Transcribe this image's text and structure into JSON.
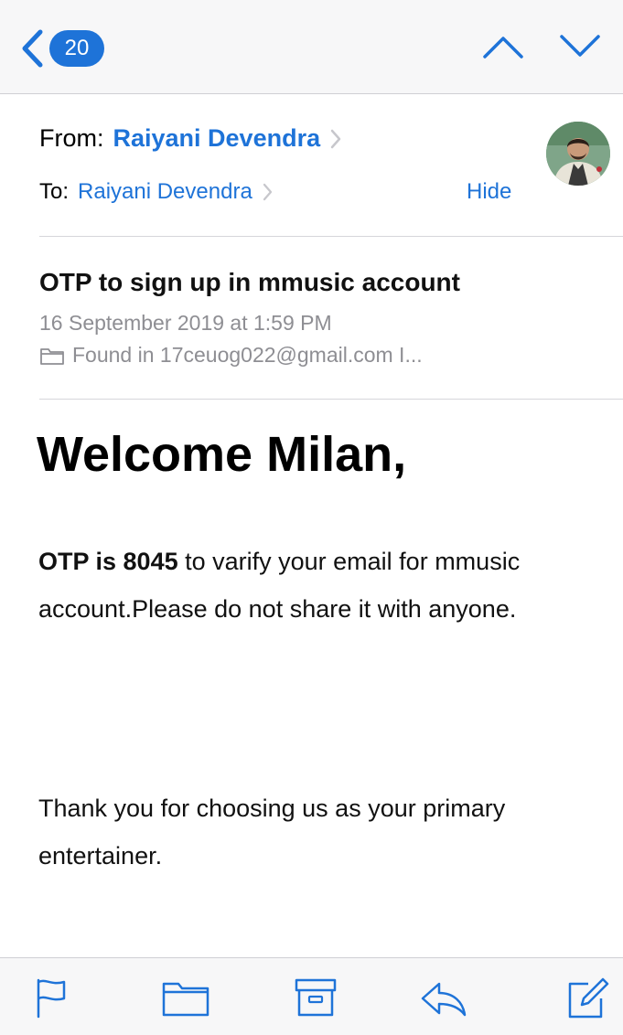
{
  "navbar": {
    "back_icon": "chevron-left-icon",
    "unread_count": "20",
    "up_icon": "chevron-up-icon",
    "down_icon": "chevron-down-icon"
  },
  "header": {
    "from_label": "From:",
    "from_name": "Raiyani Devendra",
    "to_label": "To:",
    "to_name": "Raiyani Devendra",
    "hide_label": "Hide",
    "avatar_icon": "avatar"
  },
  "message": {
    "subject": "OTP to sign up in mmusic account",
    "date": "16 September 2019 at 1:59 PM",
    "found_in": "Found in 17ceuog022@gmail.com I..."
  },
  "body": {
    "greeting": "Welcome Milan,",
    "otp_bold": "OTP is 8045",
    "otp_rest": " to varify your email for mmusic account.Please do not share it with anyone.",
    "thanks": "Thank you for choosing us as your primary entertainer."
  },
  "toolbar": {
    "items": [
      "flag-icon",
      "folder-icon",
      "archive-icon",
      "reply-icon",
      "compose-icon"
    ]
  },
  "colors": {
    "accent": "#1e73d8",
    "secondary_text": "#8e8e93",
    "bar_background": "#f7f7f8"
  }
}
